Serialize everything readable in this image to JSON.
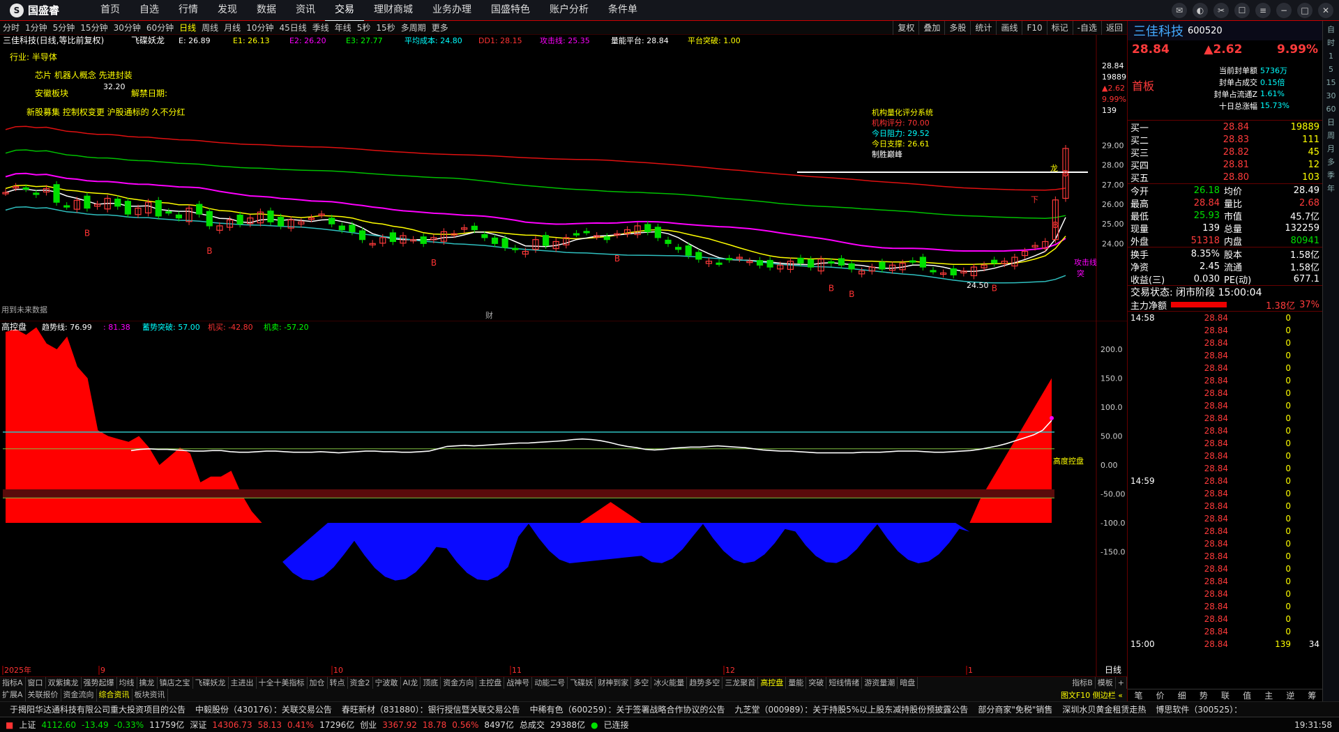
{
  "app": {
    "logo": "国盛睿",
    "nav": [
      "首页",
      "自选",
      "行情",
      "发现",
      "数据",
      "资讯",
      "交易",
      "理财商城",
      "业务办理",
      "国盛特色",
      "账户分析",
      "条件单"
    ],
    "active_nav": "交易"
  },
  "periods": [
    "分时",
    "1分钟",
    "5分钟",
    "15分钟",
    "30分钟",
    "60分钟",
    "日线",
    "周线",
    "月线",
    "10分钟",
    "45日线",
    "季线",
    "年线",
    "5秒",
    "15秒",
    "多周期",
    "更多"
  ],
  "active_period": "日线",
  "tools": [
    "复权",
    "叠加",
    "多股",
    "统计",
    "画线",
    "F10",
    "标记",
    "-自选",
    "返回"
  ],
  "main_legend": {
    "name": "三佳科技(日线,等比前复权)",
    "ind": "飞碟妖龙",
    "e": "E: 26.89",
    "e1": "E1: 26.13",
    "e2": "E2: 26.20",
    "e3": "E3: 27.77",
    "avg": "平均成本: 24.80",
    "dd1": "DD1: 28.15",
    "atk": "攻击线: 25.35",
    "vol": "量能平台: 28.84",
    "plat": "平台突破: 1.00"
  },
  "annotations": {
    "industry": "行业: 半导体",
    "concept": "芯片 机器人概念 先进封装",
    "sector": "安徽板块",
    "note": "新股募集 控制权变更 沪股通标的 久不分红",
    "unlock": "解禁日期:",
    "high": "32.20",
    "low": "24.50",
    "future": "用到未来数据",
    "cai": "财",
    "b_label": "B",
    "dragon": "龙",
    "attack_line": "攻击线",
    "tu_po": "突",
    "xia": "下"
  },
  "score": {
    "title": "机构量化评分系统",
    "s1": "机构评分: 70.00",
    "s2": "今日阻力: 29.52",
    "s3": "今日支撑: 26.61",
    "s4": "制胜巅峰"
  },
  "price_axis": [
    "29.00",
    "28.00",
    "27.00",
    "26.00",
    "25.00",
    "24.00"
  ],
  "price_info": [
    "28.84",
    "19889",
    "▲2.62",
    "9.99%",
    "139"
  ],
  "sub_legend": {
    "name": "高控盘",
    "trend": "趋势线: 76.99",
    "v2": ": 81.38",
    "v3": "蓄势突破: 57.00",
    "v4": "机买: -42.80",
    "v5": "机卖: -57.20"
  },
  "sub_axis": [
    "200.0",
    "150.0",
    "100.0",
    "50.00",
    "0.00",
    "-50.00",
    "-100.0",
    "-150.0"
  ],
  "sub_label": "高度控盘",
  "date_labels": [
    "2025年",
    "9",
    "10",
    "11",
    "12",
    "1"
  ],
  "period_label": "日线",
  "tabs": [
    "指标A",
    "窗口",
    "双紫擒龙",
    "强势起爆",
    "均线",
    "擒龙",
    "镇店之宝",
    "飞碟妖龙",
    "主进出",
    "十全十美指标",
    "加仓",
    "转点",
    "资金2",
    "宁波敢",
    "AI龙",
    "顶底",
    "资金方向",
    "主控盘",
    "战神号",
    "动能二号",
    "飞碟妖",
    "财神到家",
    "多空",
    "冰火能量",
    "趋势多空",
    "三龙聚首",
    "高控盘",
    "量能",
    "突破",
    "短线情绪",
    "游资量潮",
    "暗盘"
  ],
  "active_tab": "高控盘",
  "tabs_right": [
    "指标B",
    "模板",
    "+"
  ],
  "tabs2": [
    "扩展A",
    "关联报价",
    "资金流向",
    "综合资讯",
    "板块资讯"
  ],
  "tabs2_active": "综合资讯",
  "tabs2_right": "图文F10 侧边栏 «",
  "news": [
    "于揭阳华达通科技有限公司重大投资项目的公告",
    "中毅股份（430176）：关联交易公告",
    "春旺新材（831880）：银行授信暨关联交易公告",
    "中稀有色（600259）：关于签署战略合作协议的公告",
    "九芝堂（000989）：关于持股5%以上股东减持股份预披露公告",
    "部分商家\"免税\"销售",
    "深圳水贝黄金租赁走热",
    "博思软件（300525）："
  ],
  "status": {
    "sh": "上证",
    "sh_val": "4112.60",
    "sh_chg": "-13.49",
    "sh_pct": "-0.33%",
    "sh_amt": "11759亿",
    "sz": "深证",
    "sz_val": "14306.73",
    "sz_chg": "58.13",
    "sz_pct": "0.41%",
    "sz_amt": "17296亿",
    "cy": "创业",
    "cy_val": "3367.92",
    "cy_chg": "18.78",
    "cy_pct": "0.56%",
    "cy_amt": "8497亿",
    "total": "总成交",
    "total_amt": "29388亿",
    "conn": "已连接",
    "time": "19:31:58"
  },
  "quote": {
    "name": "三佳科技",
    "code": "600520",
    "price": "28.84",
    "change": "▲2.62",
    "pct": "9.99%",
    "limit": "首板",
    "seal": [
      [
        "当前封单额",
        "5736万"
      ],
      [
        "封单占成交",
        "0.15倍"
      ],
      [
        "封单占流通Z",
        "1.61%"
      ],
      [
        "十日总涨幅",
        "15.73%"
      ]
    ],
    "bids": [
      [
        "买一",
        "28.84",
        "19889"
      ],
      [
        "买二",
        "28.83",
        "111"
      ],
      [
        "买三",
        "28.82",
        "45"
      ],
      [
        "买四",
        "28.81",
        "12"
      ],
      [
        "买五",
        "28.80",
        "103"
      ]
    ],
    "stats": [
      [
        "今开",
        "26.18",
        "均价",
        "28.49"
      ],
      [
        "最高",
        "28.84",
        "量比",
        "2.68"
      ],
      [
        "最低",
        "25.93",
        "市值",
        "45.7亿"
      ],
      [
        "现量",
        "139",
        "总量",
        "132259"
      ],
      [
        "外盘",
        "51318",
        "内盘",
        "80941"
      ]
    ],
    "stats2": [
      [
        "换手",
        "8.35%",
        "股本",
        "1.58亿"
      ],
      [
        "净资",
        "2.45",
        "流通",
        "1.58亿"
      ],
      [
        "收益(三)",
        "0.030",
        "PE(动)",
        "677.1"
      ]
    ],
    "state": "交易状态: 闭市阶段 15:00:04",
    "flow_label": "主力净额",
    "flow_val": "1.38亿",
    "flow_pct": "37%",
    "ticks_t1": "14:58",
    "ticks_t2": "14:59",
    "ticks_t3": "15:00",
    "tick_price": "28.84",
    "tick_vol": "0",
    "last_vol": "139",
    "last_n": "34",
    "bottom_tabs": [
      "笔",
      "价",
      "细",
      "势",
      "联",
      "值",
      "主",
      "逆",
      "筹"
    ]
  },
  "sidebar": [
    "自",
    "时",
    "1",
    "5",
    "15",
    "30",
    "60",
    "日",
    "周",
    "月",
    "多",
    "季",
    "年"
  ],
  "colors": {
    "up": "#ff3b3b",
    "down": "#00e000",
    "ma_white": "#ffffff",
    "ma_yellow": "#ffff00",
    "ma_mag": "#ff00ff",
    "ma_green": "#00c000",
    "ma_red": "#e01010",
    "ma_cyan": "#2fc0c0",
    "blue": "#0a0aff"
  },
  "chart_data": {
    "type": "candlestick",
    "note_series": "daily",
    "price_range": [
      23.5,
      30.0
    ],
    "closes": [
      26.6,
      26.9,
      26.8,
      26.5,
      26.8,
      26.1,
      25.9,
      26.2,
      25.8,
      26.0,
      26.3,
      25.9,
      25.5,
      25.8,
      26.1,
      25.4,
      25.6,
      25.3,
      25.8,
      25.5,
      24.9,
      24.9,
      25.2,
      25.0,
      25.3,
      25.6,
      25.1,
      24.9,
      25.2,
      25.1,
      25.3,
      25.5,
      25.0,
      24.7,
      24.6,
      24.2,
      24.0,
      24.3,
      24.1,
      24.4,
      24.2,
      24.0,
      24.3,
      24.6,
      24.5,
      24.8,
      24.7,
      24.3,
      24.0,
      23.8,
      23.7,
      23.6,
      24.2,
      23.9,
      24.1,
      24.3,
      24.5,
      24.6,
      24.4,
      24.2,
      24.5,
      24.7,
      24.9,
      24.6,
      24.3,
      24.0,
      23.7,
      23.4,
      23.2,
      23.1,
      23.0,
      23.2,
      23.3,
      23.1,
      22.9,
      22.8,
      22.9,
      23.1,
      23.0,
      22.8,
      23.2,
      23.0,
      22.9,
      22.7,
      22.6,
      22.8,
      22.7,
      22.9,
      23.0,
      23.1,
      22.8,
      22.6,
      22.5,
      22.4,
      22.6,
      22.8,
      22.9,
      23.0,
      23.1,
      23.3,
      23.6,
      23.9,
      24.1,
      26.22,
      28.84
    ],
    "gkp_trend": [
      25,
      27,
      28,
      27,
      27,
      26,
      25,
      24,
      24,
      25,
      25,
      23,
      22,
      22,
      23,
      24,
      24,
      23,
      22,
      22,
      22,
      23,
      22,
      21,
      22,
      23,
      24,
      24,
      23,
      23,
      22,
      22,
      23,
      24,
      28,
      32,
      33,
      34,
      33,
      34,
      35,
      36,
      37,
      38,
      38,
      39,
      40,
      41,
      42,
      44,
      45,
      44,
      42,
      39,
      35,
      32,
      30,
      27,
      26,
      27,
      29,
      30,
      31,
      31,
      32,
      33,
      32,
      31,
      30,
      28,
      26,
      25,
      24,
      24,
      23,
      22,
      21,
      21,
      21,
      21,
      21,
      22,
      22,
      22,
      23,
      24,
      24,
      24,
      23,
      22,
      22,
      23,
      24,
      25,
      27,
      30,
      33,
      37,
      42,
      47,
      52,
      60,
      76.99
    ]
  }
}
